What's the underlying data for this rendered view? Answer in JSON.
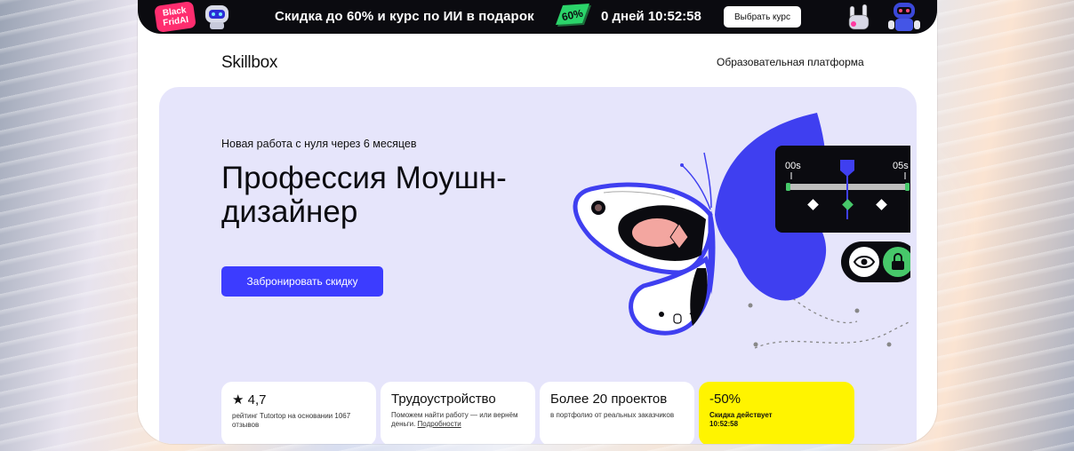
{
  "promo": {
    "badge_line1": "Black",
    "badge_line2": "FridAI",
    "text": "Скидка до 60% и курс по ИИ в подарок",
    "percent_badge": "60%",
    "timer": "0 дней 10:52:58",
    "button": "Выбрать курс"
  },
  "header": {
    "logo": "Skillbox",
    "nav_link": "Образовательная платформа"
  },
  "hero": {
    "eyebrow": "Новая работа с нуля через 6 месяцев",
    "title": "Профессия Моушн-дизайнер",
    "cta": "Забронировать скидку",
    "timeline": {
      "start_label": "00s",
      "end_label": "05s"
    }
  },
  "cards": [
    {
      "title": "★ 4,7",
      "sub": "рейтинг Tutortop на основании 1067 отзывов"
    },
    {
      "title": "Трудоустройство",
      "sub": "Поможем найти работу — или вернём деньги.",
      "link": "Подробности"
    },
    {
      "title": "Более 20 проектов",
      "sub": "в портфолио от реальных заказчиков"
    },
    {
      "title": "-50%",
      "sub_line1": "Скидка  действует",
      "sub_line2": "10:52:58"
    }
  ],
  "colors": {
    "accent": "#3c3cff",
    "hero_bg": "#e6e5fb",
    "promo_bg": "#0b0b10",
    "discount_card": "#fff400",
    "butterfly_blue": "#3f3ff0",
    "green": "#47c86a"
  }
}
